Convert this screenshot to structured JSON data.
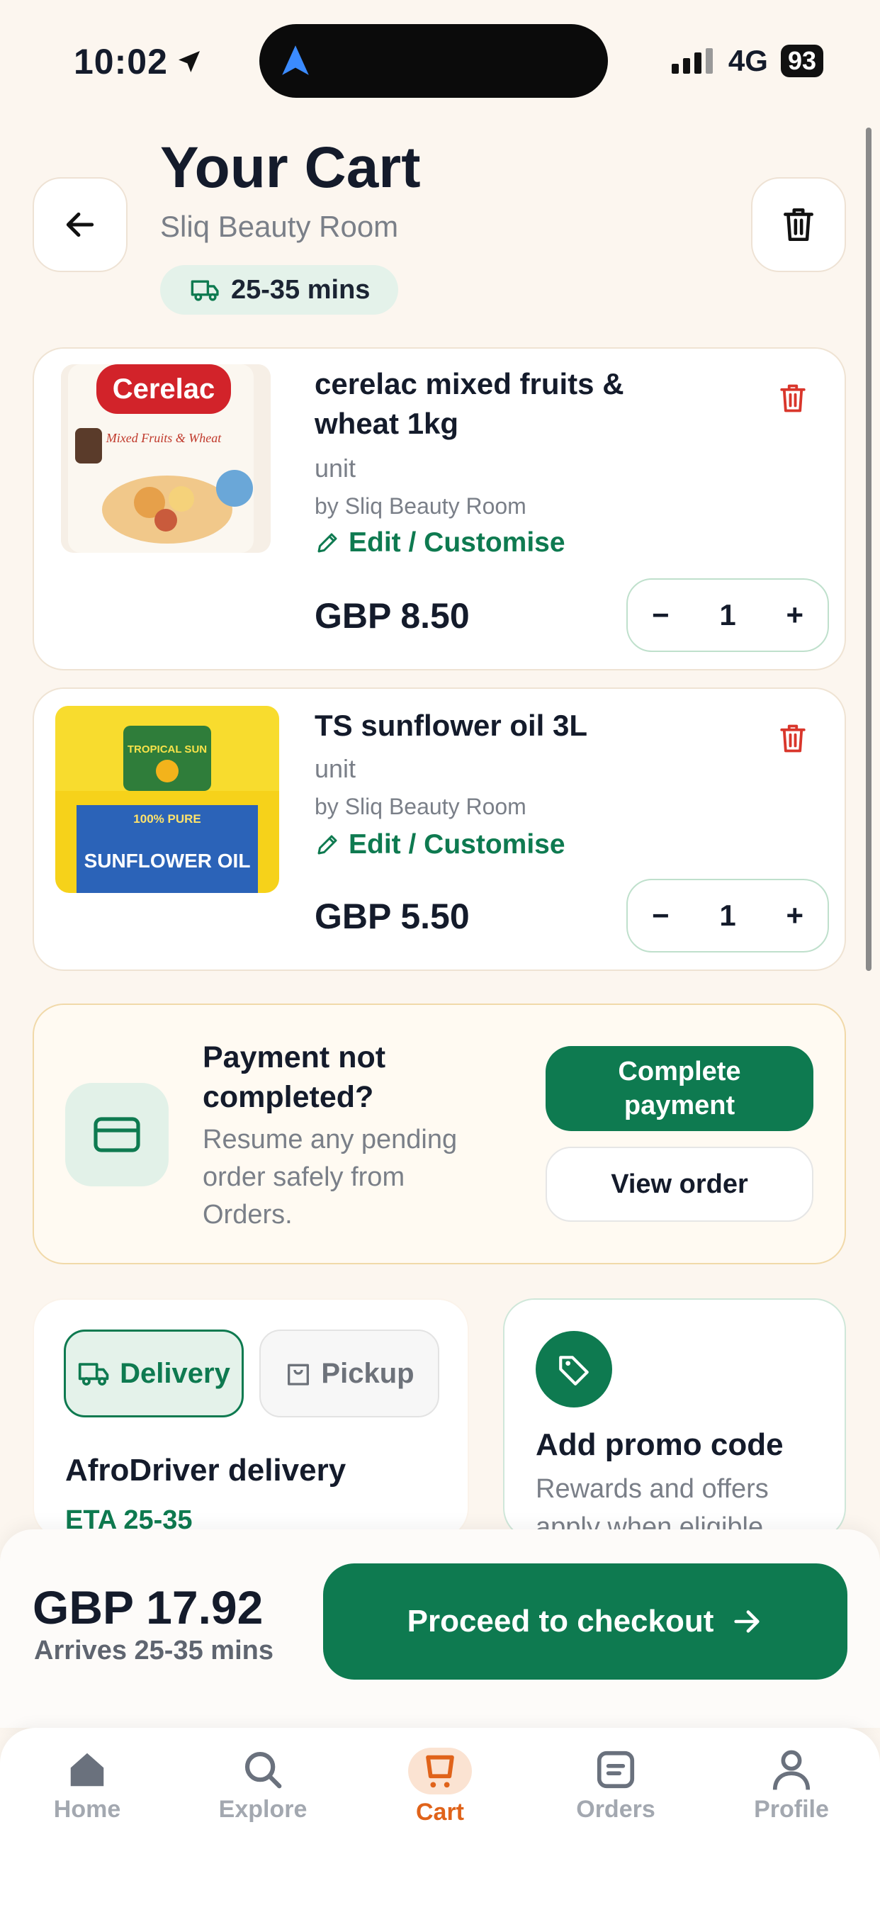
{
  "status_bar": {
    "time": "10:02",
    "network": "4G",
    "battery": "93"
  },
  "header": {
    "title": "Your Cart",
    "store": "Sliq Beauty Room",
    "eta": "25-35 mins"
  },
  "items": [
    {
      "name": "cerelac mixed fruits & wheat 1kg",
      "unit": "unit",
      "seller": "by Sliq Beauty Room",
      "edit_label": "Edit / Customise",
      "price": "GBP 8.50",
      "quantity": "1",
      "image": {
        "brand": "Cerelac",
        "caption": "Mixed Fruits & Wheat"
      }
    },
    {
      "name": "TS sunflower oil 3L",
      "unit": "unit",
      "seller": "by Sliq Beauty Room",
      "edit_label": "Edit / Customise",
      "price": "GBP 5.50",
      "quantity": "1",
      "image": {
        "brand": "TROPICAL SUN",
        "caption": "100% PURE",
        "product": "SUNFLOWER OIL"
      }
    }
  ],
  "payment_notice": {
    "title": "Payment not completed?",
    "subtitle": "Resume any pending order safely from Orders.",
    "primary_label": "Complete payment",
    "secondary_label": "View order"
  },
  "fulfilment": {
    "delivery_label": "Delivery",
    "pickup_label": "Pickup",
    "option_title": "AfroDriver delivery",
    "option_eta": "ETA 25-35"
  },
  "promo": {
    "title": "Add promo code",
    "subtitle": "Rewards and offers apply when eligible"
  },
  "checkout": {
    "total": "GBP 17.92",
    "arrives": "Arrives 25-35 mins",
    "button_label": "Proceed to checkout"
  },
  "nav": [
    {
      "label": "Home",
      "icon": "home-icon"
    },
    {
      "label": "Explore",
      "icon": "search-icon"
    },
    {
      "label": "Cart",
      "icon": "cart-icon"
    },
    {
      "label": "Orders",
      "icon": "orders-icon"
    },
    {
      "label": "Profile",
      "icon": "profile-icon"
    }
  ],
  "colors": {
    "background": "#fcf6ef",
    "accent_green": "#0e7a50",
    "active_nav": "#e0631a",
    "danger": "#d9362b"
  }
}
